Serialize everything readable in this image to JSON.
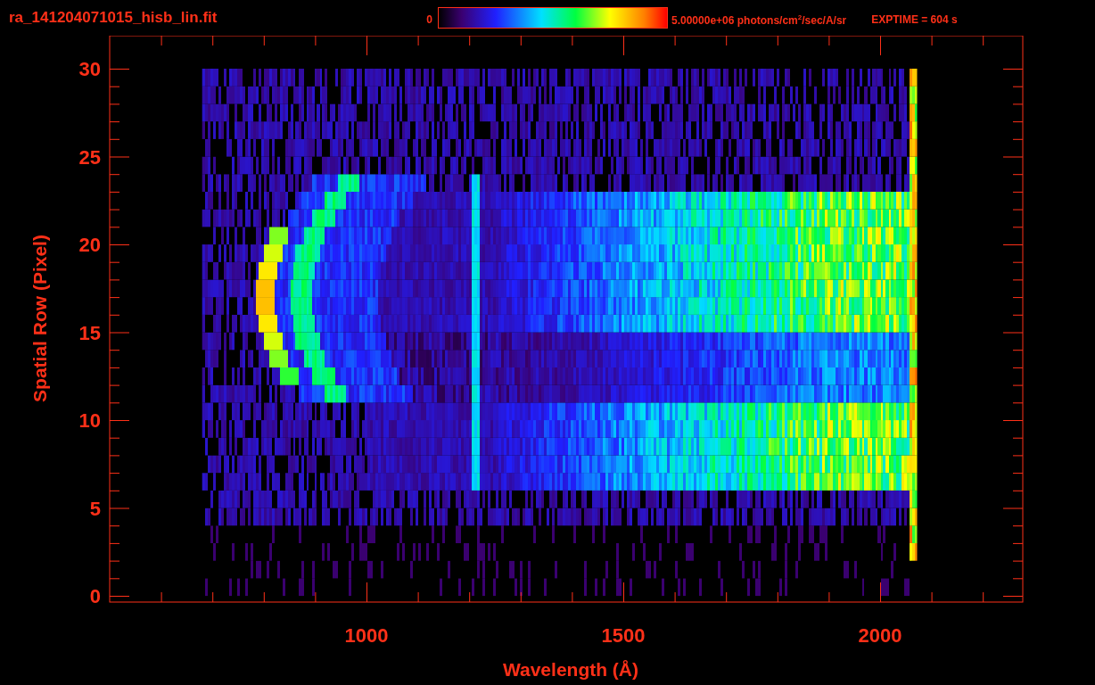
{
  "header": {
    "title": "ra_141204071015_hisb_lin.fit",
    "colorbar": {
      "min_label": "0",
      "max_label": "5.00000e+06 photons/cm$^{2}$/sec/A/sr"
    },
    "exposure": "EXPTIME = 604 s"
  },
  "plot": {
    "y_title": "Spatial Row (Pixel)",
    "x_title": "Wavelength (Å)",
    "y_ticks": [
      "30",
      "25",
      "20",
      "15",
      "10",
      "5",
      "0"
    ],
    "x_ticks": [
      "1000",
      "1500",
      "2000"
    ]
  }
}
